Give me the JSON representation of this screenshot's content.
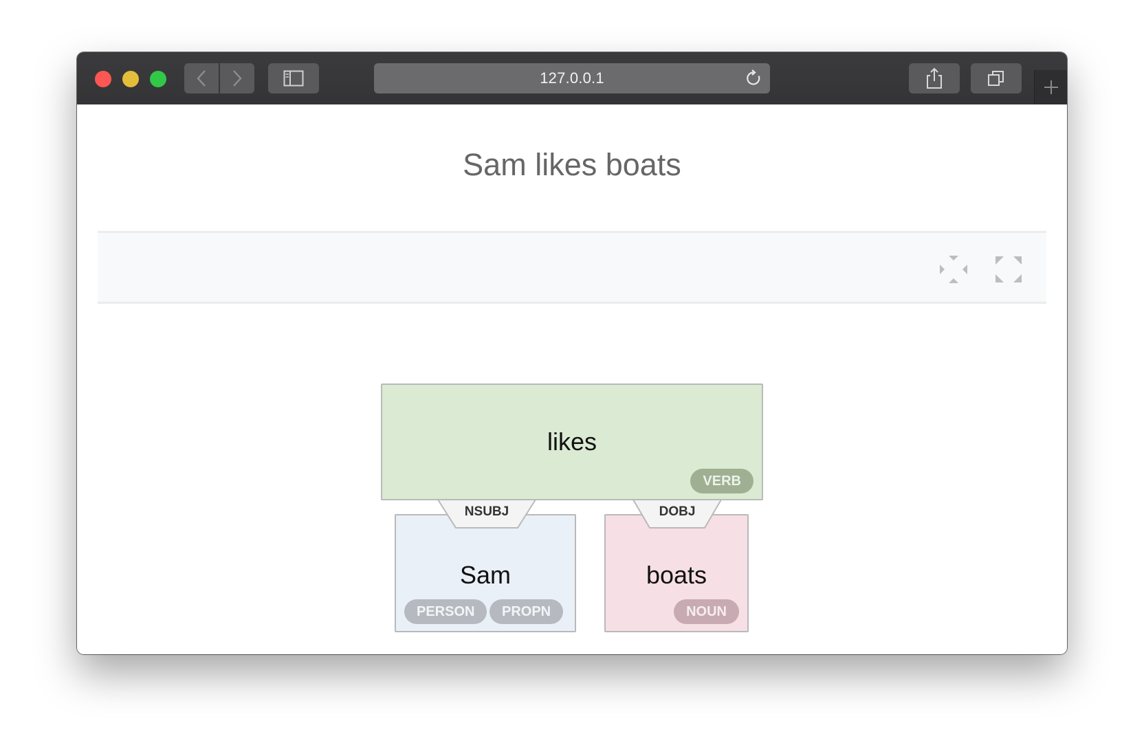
{
  "browser": {
    "url": "127.0.0.1"
  },
  "page": {
    "title": "Sam likes boats"
  },
  "toolbar": {
    "collapse_icon": "collapse-arrows-icon",
    "expand_icon": "expand-corners-icon"
  },
  "tree": {
    "root": {
      "word": "likes",
      "tags": [
        "VERB"
      ],
      "color": "#dbead2"
    },
    "children": [
      {
        "relation": "NSUBJ",
        "word": "Sam",
        "tags": [
          "PERSON",
          "PROPN"
        ],
        "color": "#eaf0f7"
      },
      {
        "relation": "DOBJ",
        "word": "boats",
        "tags": [
          "NOUN"
        ],
        "color": "#f7dfe6"
      }
    ]
  }
}
